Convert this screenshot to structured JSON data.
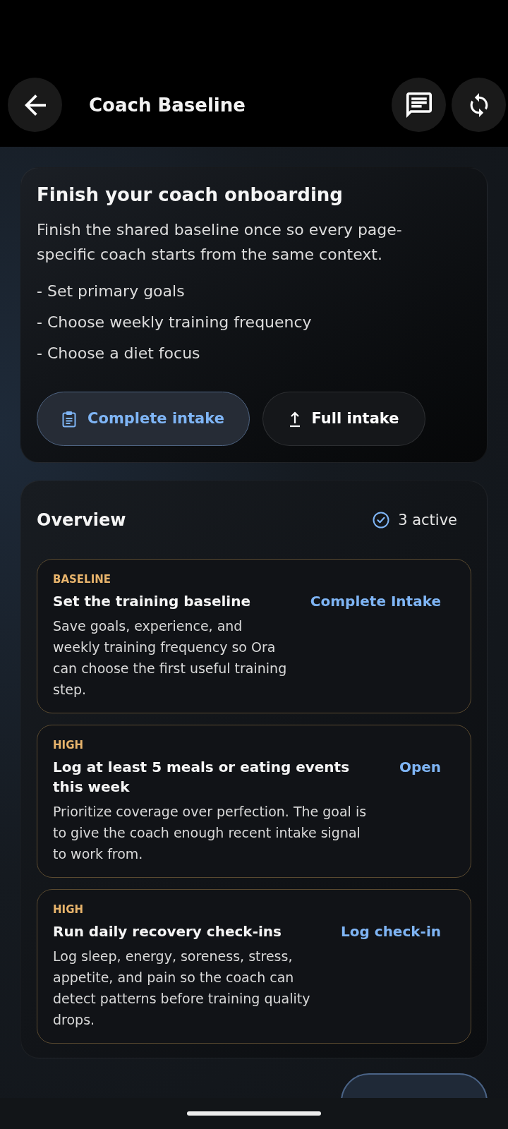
{
  "header": {
    "title": "Coach Baseline"
  },
  "onboarding_card": {
    "title": "Finish your coach onboarding",
    "description": "Finish the shared baseline once so every page-specific coach starts from the same context.",
    "checklist": [
      "- Set primary goals",
      "- Choose weekly training frequency",
      "- Choose a diet focus"
    ],
    "buttons": [
      {
        "label": "Complete intake",
        "kind": "primary"
      },
      {
        "label": "Full intake",
        "kind": "secondary"
      }
    ]
  },
  "overview": {
    "title": "Overview",
    "active_count": "3 active",
    "tasks": [
      {
        "tag": "BASELINE",
        "title": "Set the training baseline",
        "description": "Save goals, experience, and weekly training frequency so Ora can choose the first useful training step.",
        "action": "Complete Intake"
      },
      {
        "tag": "HIGH",
        "title": "Log at least 5 meals or eating events this week",
        "description": "Prioritize coverage over perfection. The goal is to give the coach enough recent intake signal to work from.",
        "action": "Open"
      },
      {
        "tag": "HIGH",
        "title": "Run daily recovery check-ins",
        "description": "Log sleep, energy, soreness, stress, appetite, and pain so the coach can detect patterns before training quality drops.",
        "action": "Log check-in"
      }
    ]
  }
}
